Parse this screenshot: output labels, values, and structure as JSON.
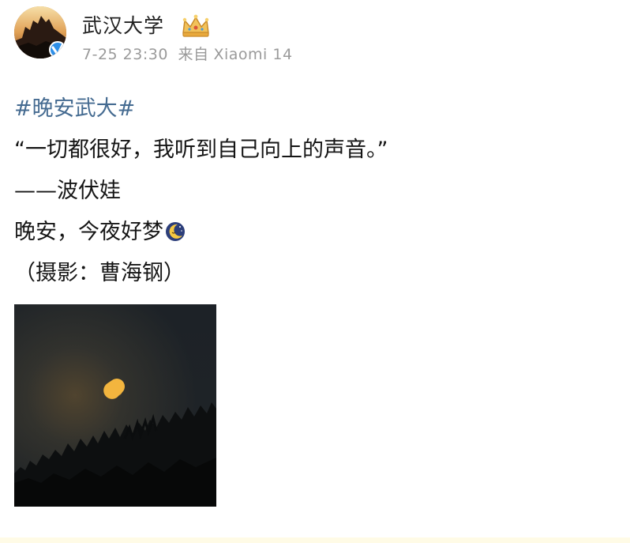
{
  "post": {
    "author": {
      "name": "武汉大学",
      "avatar_icon": "wuhan-university-avatar",
      "verified_icon": "verified-badge-icon",
      "badge_icon": "crown-badge-icon"
    },
    "meta": {
      "time": "7-25 23:30",
      "source_prefix": "来自",
      "device": "Xiaomi 14"
    },
    "content": {
      "hashtag": "#晚安武大#",
      "quote": "“一切都很好，我听到自己向上的声音。”",
      "attribution": "——波伏娃",
      "goodnight": "晚安，今夜好梦",
      "goodnight_emoji": "sleepy-moon-emoji",
      "credit": "（摄影：曹海钢）"
    },
    "image": {
      "icon": "night-moon-photo"
    }
  },
  "colors": {
    "hashtag": "#456b91",
    "meta": "#9a9a9a",
    "verified": "#2e8fe8",
    "crown": "#e3b04a"
  }
}
